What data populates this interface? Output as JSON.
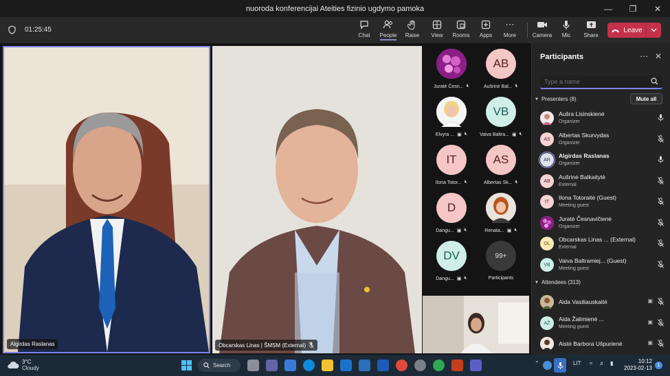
{
  "window": {
    "title": "nuoroda konferencijai Ateities fizinio ugdymo pamoka"
  },
  "toolbar": {
    "timer": "01:25:45",
    "buttons": [
      {
        "label": "Chat",
        "icon": "chat-icon"
      },
      {
        "label": "People",
        "icon": "people-icon"
      },
      {
        "label": "Raise",
        "icon": "raise-hand-icon"
      },
      {
        "label": "View",
        "icon": "view-grid-icon"
      },
      {
        "label": "Rooms",
        "icon": "rooms-icon"
      },
      {
        "label": "Apps",
        "icon": "apps-icon"
      },
      {
        "label": "More",
        "icon": "more-icon"
      },
      {
        "label": "Camera",
        "icon": "camera-icon"
      },
      {
        "label": "Mic",
        "icon": "mic-icon"
      },
      {
        "label": "Share",
        "icon": "share-icon"
      }
    ],
    "leave_label": "Leave"
  },
  "stage": {
    "video1_name": "Algirdas Raslanas",
    "video2_name": "Obcarskas Linas | ŠMSM (External)",
    "tiles": [
      {
        "initials": "",
        "label": "Juratė Česn...",
        "style": "photo-flower"
      },
      {
        "initials": "AB",
        "label": "Aušrinė Bal...",
        "style": "pink"
      },
      {
        "initials": "",
        "label": "Elvyra ...",
        "style": "photo-blonde"
      },
      {
        "initials": "VB",
        "label": "Vaiva Baltra...",
        "style": "teal"
      },
      {
        "initials": "IT",
        "label": "Ilona Totor...",
        "style": "pink"
      },
      {
        "initials": "AS",
        "label": "Albertas Sk...",
        "style": "pink"
      },
      {
        "initials": "D",
        "label": "Dangu...",
        "style": "pink"
      },
      {
        "initials": "",
        "label": "Renata...",
        "style": "photo-red"
      },
      {
        "initials": "DV",
        "label": "Dangu...",
        "style": "teal"
      },
      {
        "initials": "99+",
        "label": "Participants",
        "style": "gray"
      }
    ]
  },
  "panel": {
    "title": "Participants",
    "search_placeholder": "Type a name",
    "presenters_header": "Presenters (8)",
    "mute_all": "Mute all",
    "attendees_header": "Attendees (313)",
    "presenters": [
      {
        "initials": "",
        "name": "Aušra Lisinskienė",
        "role": "Organizer",
        "avatar": "photo",
        "mic": "on"
      },
      {
        "initials": "AS",
        "name": "Albertas Skurvydas",
        "role": "Organizer",
        "avatar": "pink",
        "mic": "off"
      },
      {
        "initials": "AR",
        "name": "Algirdas Raslanas",
        "role": "Organizer",
        "avatar": "selected",
        "mic": "on"
      },
      {
        "initials": "AB",
        "name": "Aušrinė Balkaitytė",
        "role": "External",
        "avatar": "pink",
        "mic": "off"
      },
      {
        "initials": "IT",
        "name": "Ilona Totoraitė (Guest)",
        "role": "Meeting guest",
        "avatar": "pink",
        "mic": "off"
      },
      {
        "initials": "",
        "name": "Juratė Česnavičienė",
        "role": "Organizer",
        "avatar": "flower",
        "mic": "off"
      },
      {
        "initials": "OL",
        "name": "Obcarskas Linas ... (External)",
        "role": "External",
        "avatar": "yellow",
        "mic": "off"
      },
      {
        "initials": "VB",
        "name": "Vaiva Baltramiej... (Guest)",
        "role": "Meeting guest",
        "avatar": "teal",
        "mic": "off"
      }
    ],
    "attendees": [
      {
        "initials": "",
        "name": "Aida Vasiliauskaitė",
        "role": "",
        "avatar": "photo"
      },
      {
        "initials": "AŽ",
        "name": "Aida Žalimienė ...",
        "role": "Meeting guest",
        "avatar": "teal"
      },
      {
        "initials": "",
        "name": "Aistė Barbora Ušpurienė",
        "role": "",
        "avatar": "photo"
      }
    ]
  },
  "taskbar": {
    "temp": "3°C",
    "weather": "Cloudy",
    "search_label": "Search",
    "lang": "LIT",
    "time": "10:12",
    "date": "2023-02-13"
  },
  "colors": {
    "accent": "#7f85f5",
    "leave": "#c4314b",
    "panel": "#242424"
  }
}
